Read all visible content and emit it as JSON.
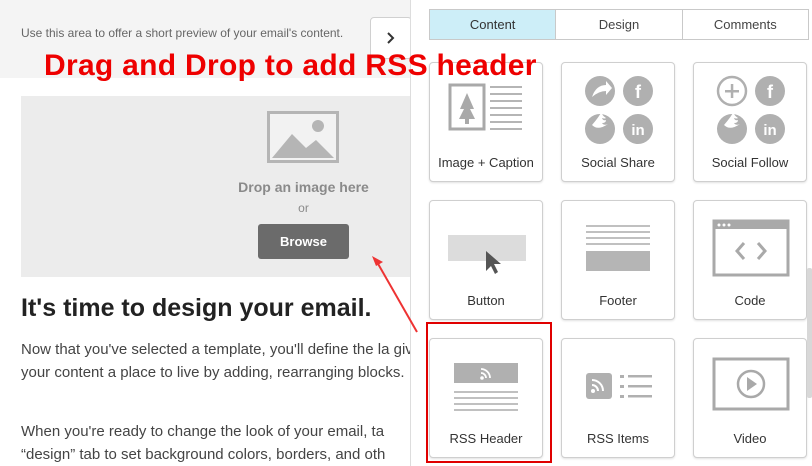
{
  "email": {
    "preview_text": "Use this area to offer a short preview of your email's content.",
    "image_block": {
      "drop_text": "Drop an image here",
      "or_text": "or",
      "browse_label": "Browse"
    },
    "heading": "It's time to design your email.",
    "paragraph1": "Now that you've selected a template, you'll define the la give your content a place to live by adding, rearranging blocks.",
    "paragraph2": "When you're ready to change the look of your email, ta “design” tab to set background colors, borders, and oth"
  },
  "annotation": {
    "text": "Drag and Drop to add RSS header",
    "color": "#ee0000"
  },
  "panel": {
    "tabs": [
      {
        "label": "Content",
        "active": true
      },
      {
        "label": "Design",
        "active": false
      },
      {
        "label": "Comments",
        "active": false
      }
    ],
    "blocks": [
      {
        "label": "Image + Caption",
        "icon": "image-caption-icon"
      },
      {
        "label": "Social Share",
        "icon": "social-share-icon"
      },
      {
        "label": "Social Follow",
        "icon": "social-follow-icon"
      },
      {
        "label": "Button",
        "icon": "button-block-icon"
      },
      {
        "label": "Footer",
        "icon": "footer-block-icon"
      },
      {
        "label": "Code",
        "icon": "code-block-icon"
      },
      {
        "label": "RSS Header",
        "icon": "rss-header-icon"
      },
      {
        "label": "RSS Items",
        "icon": "rss-items-icon"
      },
      {
        "label": "Video",
        "icon": "video-block-icon"
      }
    ],
    "active_tab_color": "#cdeef8"
  }
}
